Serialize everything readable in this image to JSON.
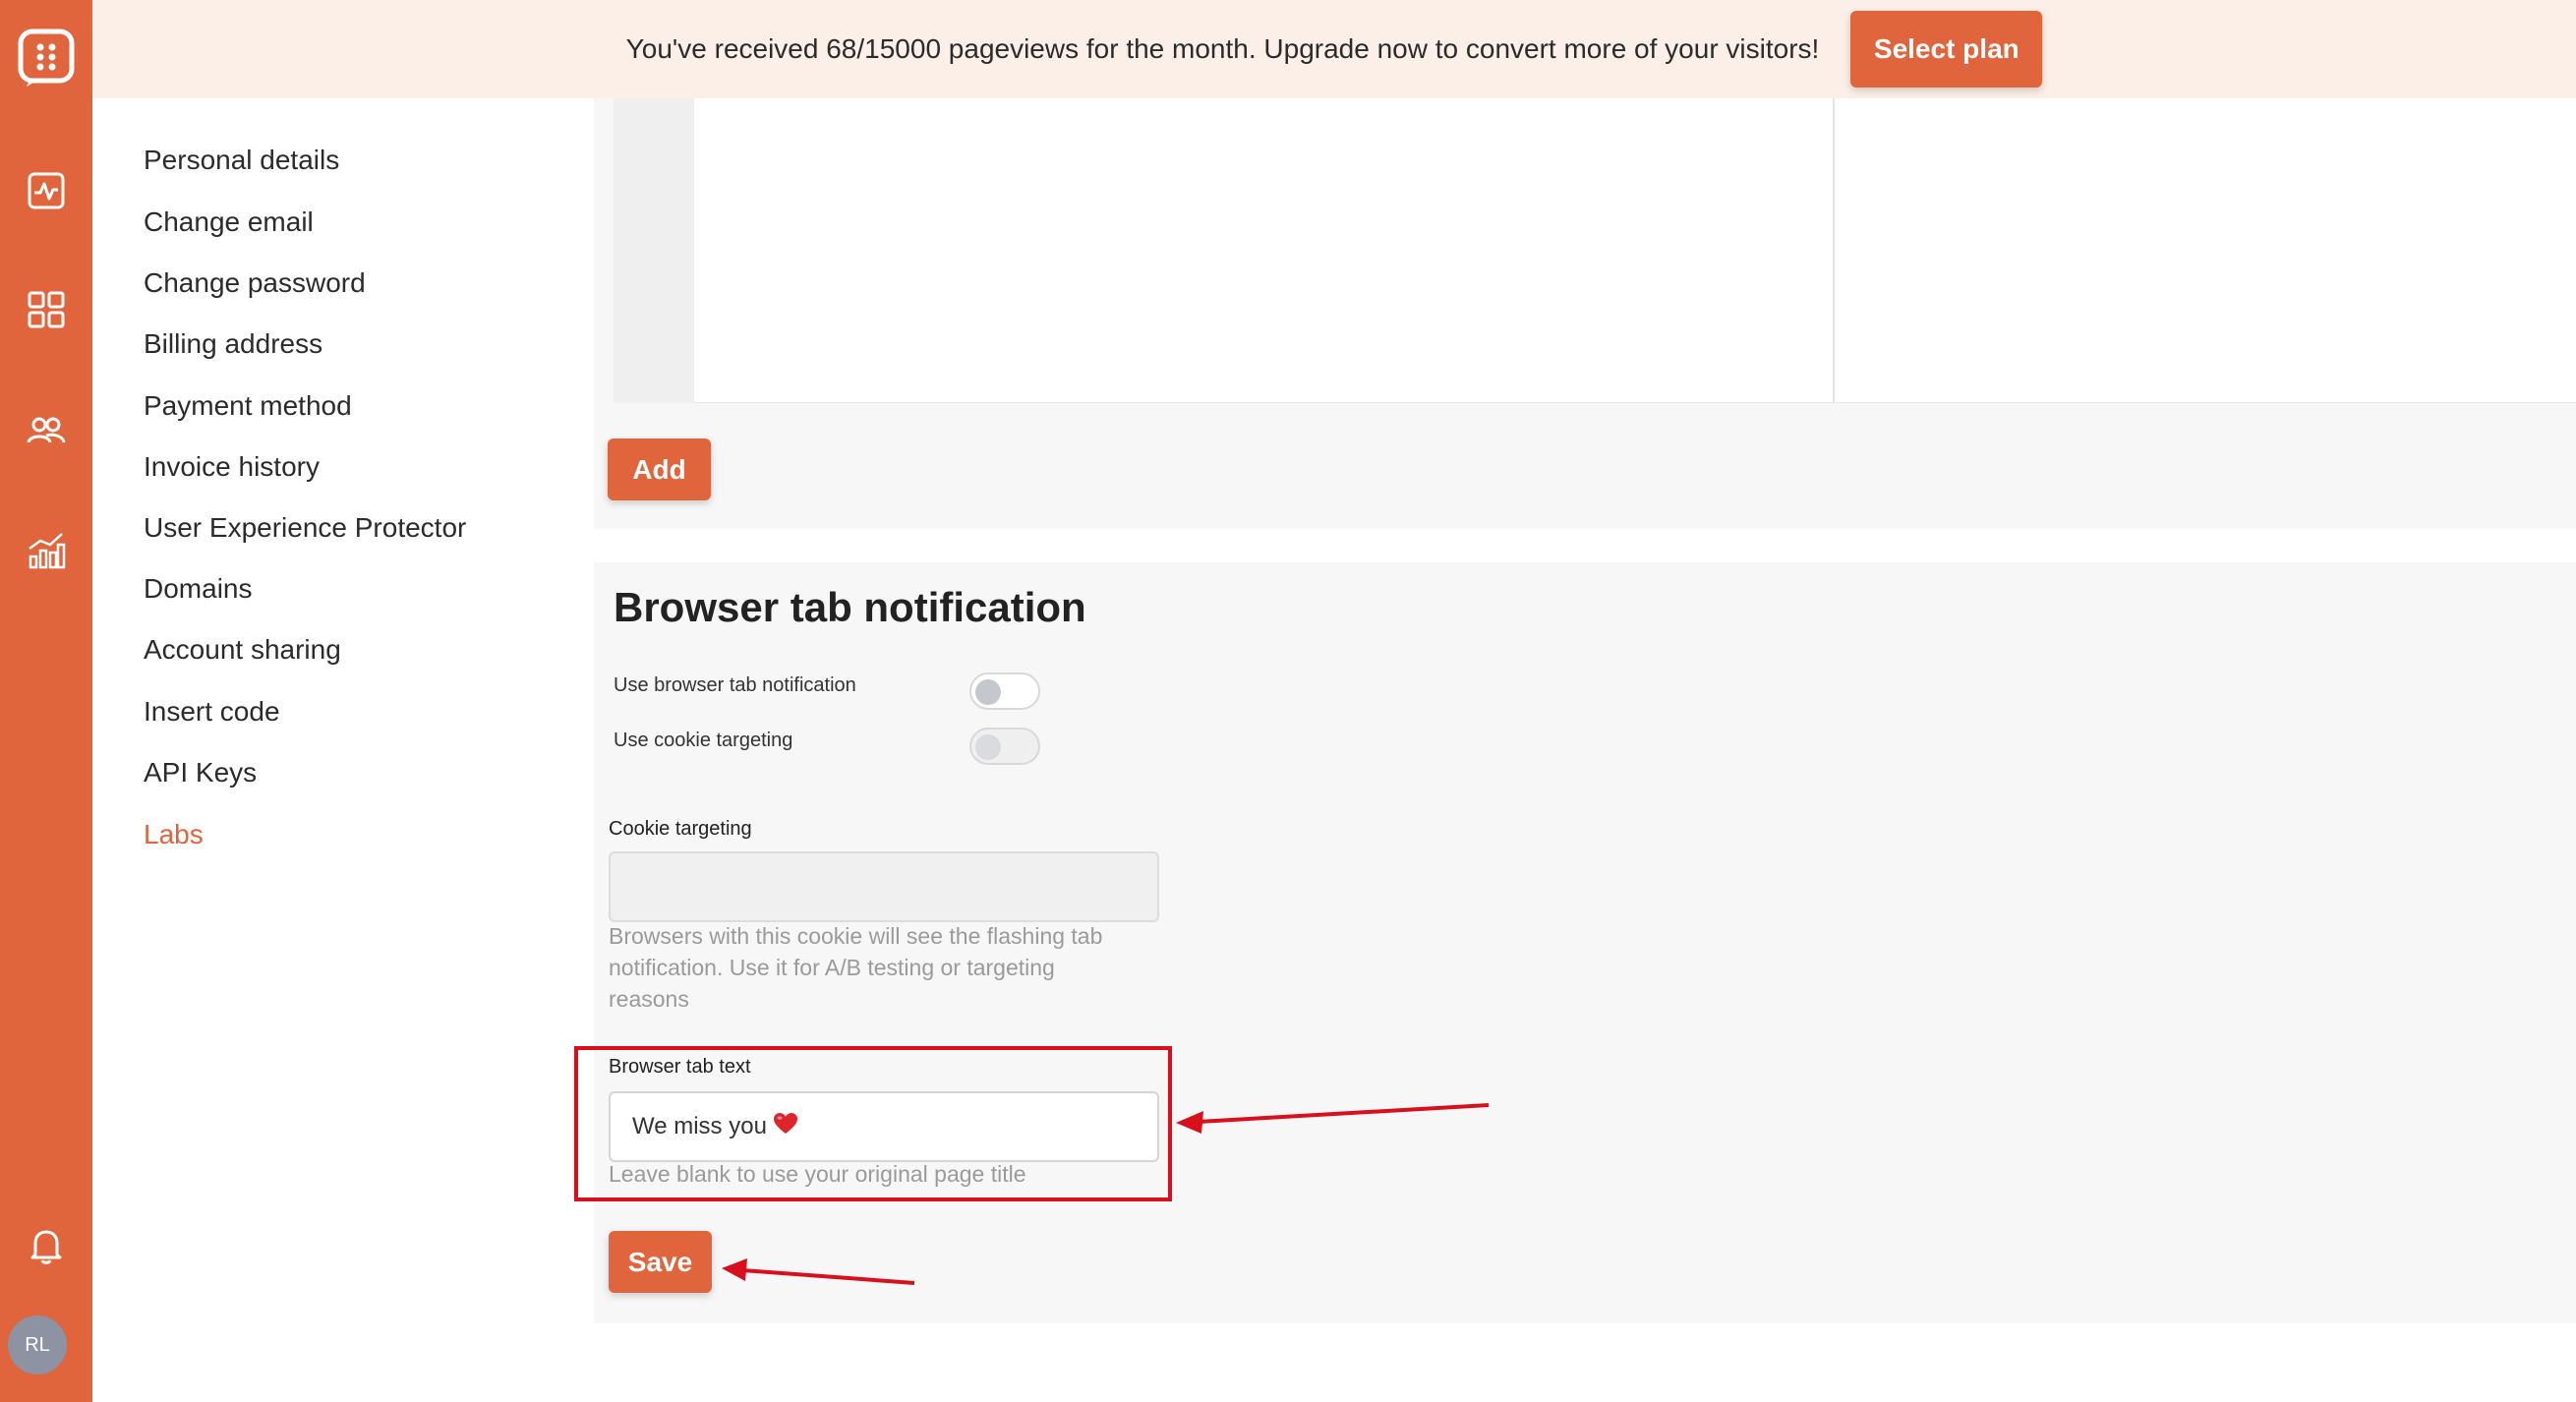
{
  "rail": {
    "icons": [
      "app-logo-icon",
      "activity-icon",
      "dashboard-grid-icon",
      "users-icon",
      "analytics-chart-icon",
      "bell-icon"
    ],
    "avatar_initials": "RL"
  },
  "banner": {
    "text": "You've received 68/15000 pageviews for the month. Upgrade now to convert more of your visitors!",
    "button_label": "Select plan"
  },
  "settings_nav": {
    "items": [
      {
        "label": "Personal details"
      },
      {
        "label": "Change email"
      },
      {
        "label": "Change password"
      },
      {
        "label": "Billing address"
      },
      {
        "label": "Payment method"
      },
      {
        "label": "Invoice history"
      },
      {
        "label": "User Experience Protector"
      },
      {
        "label": "Domains"
      },
      {
        "label": "Account sharing"
      },
      {
        "label": "Insert code"
      },
      {
        "label": "API Keys"
      },
      {
        "label": "Labs",
        "active": true
      }
    ]
  },
  "panel_top": {
    "add_label": "Add"
  },
  "browser_tab": {
    "title": "Browser tab notification",
    "toggle_notification_label": "Use browser tab notification",
    "toggle_cookie_label": "Use cookie targeting",
    "cookie_label": "Cookie targeting",
    "cookie_value": "",
    "cookie_help_lines": [
      "Browsers with this cookie will see the flashing tab",
      "notification. Use it for A/B testing or targeting",
      "reasons"
    ],
    "tab_text_label": "Browser tab text",
    "tab_text_value": "We miss you",
    "tab_text_emoji": "❤️",
    "tab_text_help": "Leave blank to use your original page title",
    "save_label": "Save"
  },
  "colors": {
    "accent": "#e0643c",
    "banner_bg": "#fcefe7",
    "annotation_red": "#d8101d"
  }
}
